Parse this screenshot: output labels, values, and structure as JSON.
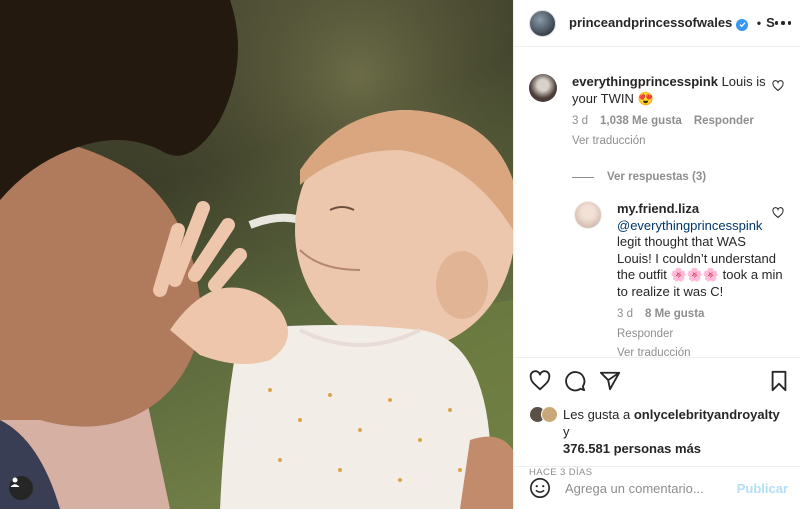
{
  "post": {
    "username": "princeandprincessofwales",
    "separator": "•",
    "follow_label": "S"
  },
  "comments": [
    {
      "username": "everythingprincesspink",
      "text": "Louis is your TWIN 😍",
      "time": "3 d",
      "likes": "1,038 Me gusta",
      "reply_label": "Responder",
      "translate_label": "Ver traducción",
      "view_replies": "Ver respuestas (3)"
    }
  ],
  "reply": {
    "username": "my.friend.liza",
    "mention": "@everythingprincesspink",
    "text": "legit thought that WAS Louis! I couldn’t understand the outfit 🌸🌸🌸 took a min to realize it was C!",
    "time": "3 d",
    "likes": "8 Me gusta",
    "reply_label": "Responder",
    "translate_label": "Ver traducción"
  },
  "likes": {
    "prefix": "Les gusta a",
    "user": "onlycelebrityandroyalty",
    "conj": "y",
    "count": "376.581 personas más"
  },
  "time_ago": "HACE 3 DÍAS",
  "add_comment": {
    "placeholder": "Agrega un comentario...",
    "post_label": "Publicar"
  }
}
